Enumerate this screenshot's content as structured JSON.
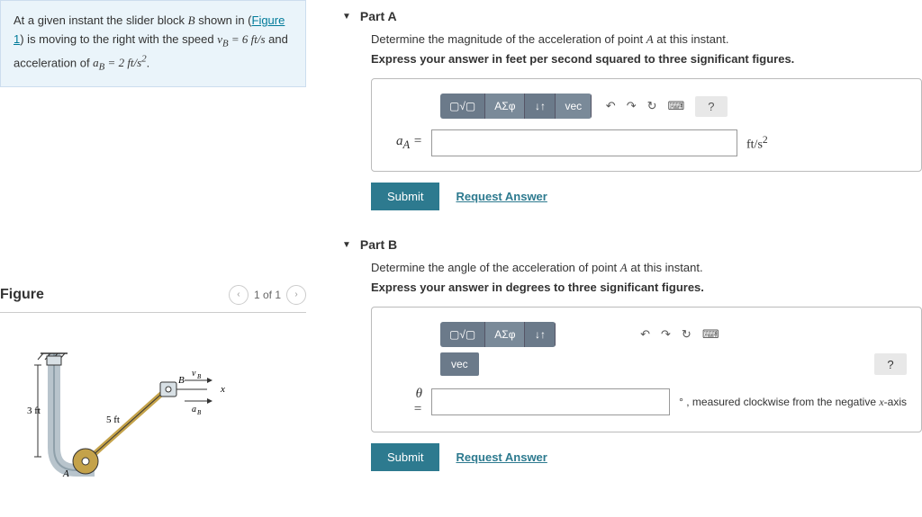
{
  "problem": {
    "text_prefix": "At a given instant the slider block ",
    "block_var": "B",
    "shown_in": " shown in (",
    "figure_link": "Figure 1",
    "text_mid1": ") is moving to the right with the speed ",
    "vB_eq": "v_B = 6 ft/s",
    "text_mid2": " and acceleration of ",
    "aB_eq": "a_B = 2 ft/s²",
    "text_end": "."
  },
  "figure": {
    "title": "Figure",
    "pager": "1 of 1"
  },
  "partA": {
    "title": "Part A",
    "prompt_pre": "Determine the magnitude of the acceleration of point ",
    "prompt_var": "A",
    "prompt_post": " at this instant.",
    "instruction": "Express your answer in feet per second squared to three significant figures.",
    "var_label": "a_A =",
    "unit": "ft/s²",
    "submit": "Submit",
    "request": "Request Answer"
  },
  "partB": {
    "title": "Part B",
    "prompt_pre": "Determine the angle of the acceleration of point ",
    "prompt_var": "A",
    "prompt_post": " at this instant.",
    "instruction": "Express your answer in degrees to three significant figures.",
    "var_label": "θ =",
    "unit_note": "° , measured clockwise from the negative x-axis",
    "submit": "Submit",
    "request": "Request Answer"
  },
  "toolbar": {
    "templates": "▢√▢",
    "greek": "ΑΣφ",
    "subsup": "↓↑",
    "vec": "vec",
    "undo": "↶",
    "redo": "↷",
    "reset": "↻",
    "keyboard": "⌨",
    "help": "?"
  }
}
